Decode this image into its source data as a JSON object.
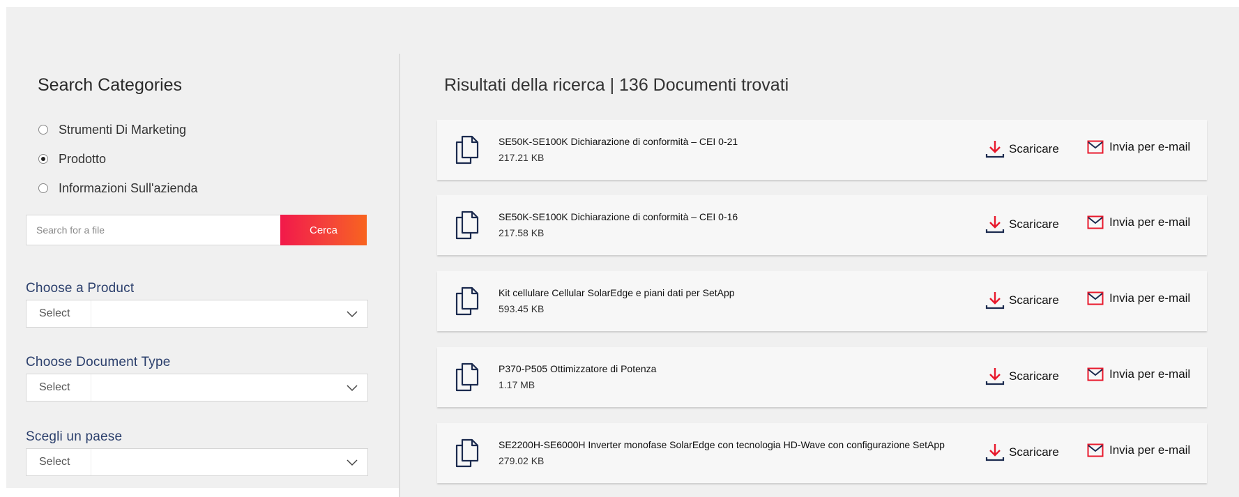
{
  "sidebar": {
    "title": "Search Categories",
    "categories": [
      {
        "label": "Strumenti Di Marketing",
        "checked": false
      },
      {
        "label": "Prodotto",
        "checked": true
      },
      {
        "label": "Informazioni Sull'azienda",
        "checked": false
      }
    ],
    "search": {
      "placeholder": "Search for a file",
      "button_label": "Cerca"
    },
    "filters": [
      {
        "label": "Choose a Product",
        "value": "Select"
      },
      {
        "label": "Choose Document Type",
        "value": "Select"
      },
      {
        "label": "Scegli un paese",
        "value": "Select"
      }
    ]
  },
  "results": {
    "title": "Risultati della ricerca | 136 Documenti trovati",
    "download_label": "Scaricare",
    "email_label": "Invia per e-mail",
    "documents": [
      {
        "name": "SE50K-SE100K Dichiarazione di conformità – CEI 0-21",
        "size": "217.21 KB"
      },
      {
        "name": "SE50K-SE100K Dichiarazione di conformità – CEI 0-16",
        "size": "217.58 KB"
      },
      {
        "name": "Kit cellulare Cellular SolarEdge e piani dati per SetApp",
        "size": "593.45 KB"
      },
      {
        "name": "P370-P505 Ottimizzatore di Potenza",
        "size": "1.17 MB"
      },
      {
        "name": "SE2200H-SE6000H Inverter monofase SolarEdge con tecnologia HD-Wave con configurazione SetApp",
        "size": "279.02 KB"
      }
    ]
  },
  "icons": {
    "document": "document-copy-icon",
    "download": "download-icon",
    "email": "envelope-icon",
    "select": "chevron-down-icon"
  },
  "colors": {
    "accent_red": "#e8192c",
    "button_gradient_start": "#f2194a",
    "button_gradient_end": "#f8641f",
    "label_blue": "#2b3f6c",
    "icon_navy": "#1b2a4e"
  }
}
